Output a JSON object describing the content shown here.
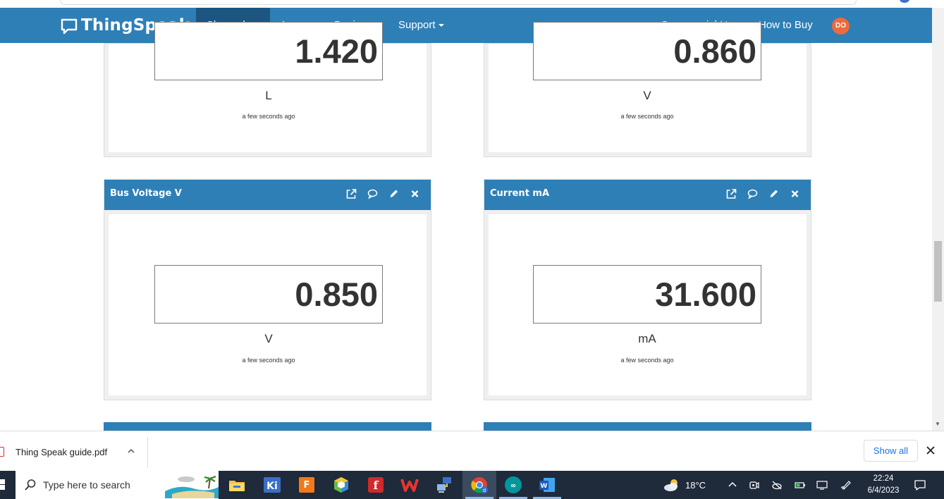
{
  "navbar": {
    "brand": "ThingSpeak",
    "brand_tm": "™",
    "menu": [
      {
        "label": "Channels",
        "dropdown": true,
        "active": true
      },
      {
        "label": "Apps",
        "dropdown": true,
        "active": false
      },
      {
        "label": "Devices",
        "dropdown": true,
        "active": false
      },
      {
        "label": "Support",
        "dropdown": true,
        "active": false
      }
    ],
    "right_links": [
      "Commercial Use",
      "How to Buy"
    ],
    "avatar_initials": "DO",
    "colors": {
      "navbar": "#2e7fb6",
      "active": "#1c5680",
      "avatar": "#ee6a3b"
    }
  },
  "widgets": {
    "top_left": {
      "value": "1.420",
      "unit": "L",
      "updated": "a few seconds ago"
    },
    "top_right": {
      "value": "0.860",
      "unit": "V",
      "updated": "a few seconds ago"
    },
    "bus_voltage": {
      "title": "Bus Voltage V",
      "value": "0.850",
      "unit": "V",
      "updated": "a few seconds ago"
    },
    "current": {
      "title": "Current mA",
      "value": "31.600",
      "unit": "mA",
      "updated": "a few seconds ago"
    },
    "card_actions": [
      "external-link-icon",
      "comment-icon",
      "pencil-icon",
      "close-icon"
    ]
  },
  "download_bar": {
    "file_name": "Thing Speak guide.pdf",
    "show_all_label": "Show all"
  },
  "taskbar": {
    "search_placeholder": "Type here to search",
    "pinned_apps": [
      "file-explorer-icon",
      "kicad-icon",
      "fusion-360-icon",
      "sketchup-icon",
      "fritzing-icon",
      "wps-office-icon",
      "network-tool-icon",
      "chrome-icon",
      "arduino-icon",
      "word-icon"
    ],
    "weather_temp": "18°C",
    "time": "22:24",
    "date": "6/4/2023"
  }
}
